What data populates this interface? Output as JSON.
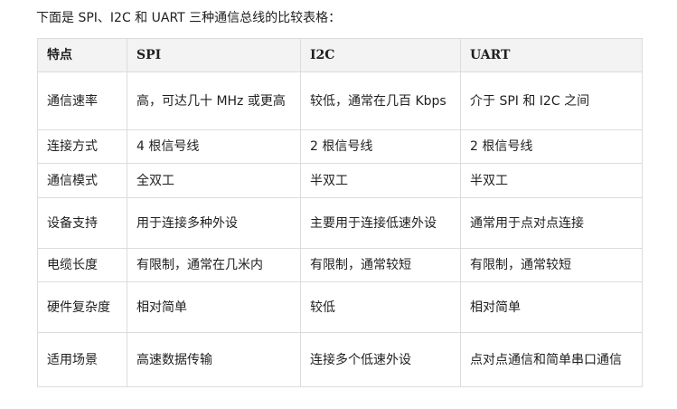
{
  "intro": "下面是 SPI、I2C 和 UART 三种通信总线的比较表格：",
  "table": {
    "headers": [
      "特点",
      "SPI",
      "I2C",
      "UART"
    ],
    "rows": [
      [
        "通信速率",
        "高，可达几十 MHz 或更高",
        "较低，通常在几百 Kbps",
        "介于 SPI 和 I2C 之间"
      ],
      [
        "连接方式",
        "4 根信号线",
        "2 根信号线",
        "2 根信号线"
      ],
      [
        "通信模式",
        "全双工",
        "半双工",
        "半双工"
      ],
      [
        "设备支持",
        "用于连接多种外设",
        "主要用于连接低速外设",
        "通常用于点对点连接"
      ],
      [
        "电缆长度",
        "有限制，通常在几米内",
        "有限制，通常较短",
        "有限制，通常较短"
      ],
      [
        "硬件复杂度",
        "相对简单",
        "较低",
        "相对简单"
      ],
      [
        "适用场景",
        "高速数据传输",
        "连接多个低速外设",
        "点对点通信和简单串口通信"
      ]
    ]
  }
}
